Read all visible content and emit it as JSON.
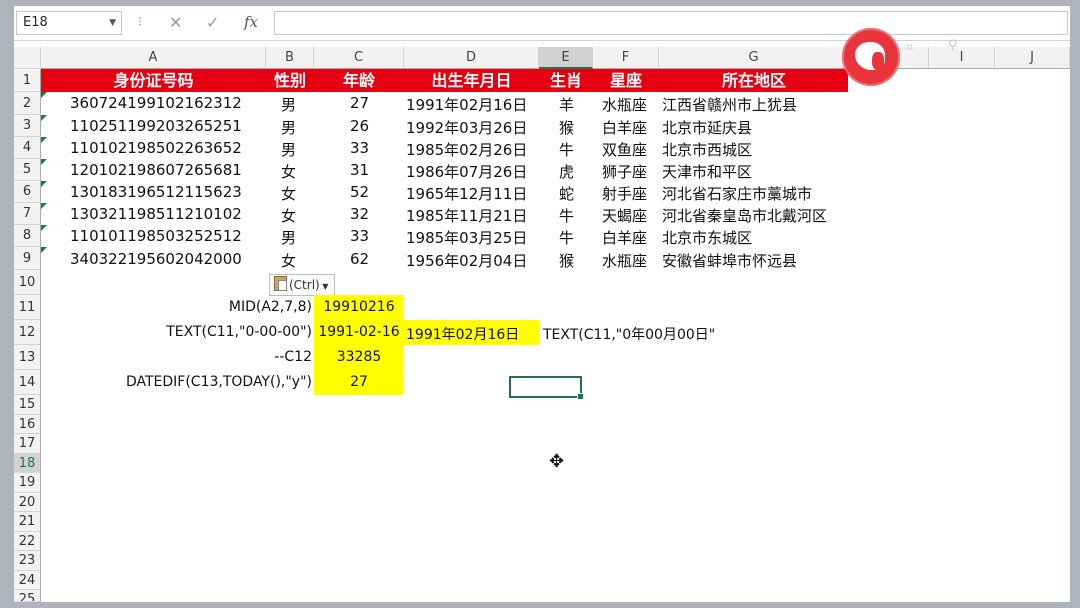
{
  "formula_bar": {
    "name_box": "E18",
    "fx_label": "fx",
    "cancel_icon": "✕",
    "enter_icon": "✓",
    "separator": "⁝"
  },
  "columns": [
    "A",
    "B",
    "C",
    "D",
    "E",
    "F",
    "G",
    "H",
    "I",
    "J"
  ],
  "rows": [
    "1",
    "2",
    "3",
    "4",
    "5",
    "6",
    "7",
    "8",
    "9",
    "10",
    "11",
    "12",
    "13",
    "14",
    "15",
    "16",
    "17",
    "18",
    "19",
    "20",
    "21",
    "22",
    "23",
    "24",
    "25"
  ],
  "header_row": [
    "身份证号码",
    "性别",
    "年龄",
    "出生年月日",
    "生肖",
    "星座",
    "所在地区"
  ],
  "data_rows": [
    [
      "360724199102162312",
      "男",
      "27",
      "1991年02月16日",
      "羊",
      "水瓶座",
      "江西省赣州市上犹县"
    ],
    [
      "110251199203265251",
      "男",
      "26",
      "1992年03月26日",
      "猴",
      "白羊座",
      "北京市延庆县"
    ],
    [
      "110102198502263652",
      "男",
      "33",
      "1985年02月26日",
      "牛",
      "双鱼座",
      "北京市西城区"
    ],
    [
      "120102198607265681",
      "女",
      "31",
      "1986年07月26日",
      "虎",
      "狮子座",
      "天津市和平区"
    ],
    [
      "130183196512115623",
      "女",
      "52",
      "1965年12月11日",
      "蛇",
      "射手座",
      "河北省石家庄市藁城市"
    ],
    [
      "130321198511210102",
      "女",
      "32",
      "1985年11月21日",
      "牛",
      "天蝎座",
      "河北省秦皇岛市北戴河区"
    ],
    [
      "110101198503252512",
      "男",
      "33",
      "1985年03月25日",
      "牛",
      "白羊座",
      "北京市东城区"
    ],
    [
      "340322195602042000",
      "女",
      "62",
      "1956年02月04日",
      "猴",
      "水瓶座",
      "安徽省蚌埠市怀远县"
    ]
  ],
  "paste_button": "(Ctrl)",
  "formulas": [
    {
      "label": "MID(A2,7,8)",
      "result": "19910216"
    },
    {
      "label": "TEXT(C11,\"0-00-00\")",
      "result": "1991-02-16",
      "extra": "1991年02月16日",
      "note": "TEXT(C11,\"0年00月00日\""
    },
    {
      "label": "--C12",
      "result": "33285"
    },
    {
      "label": "DATEDIF(C13,TODAY(),\"y\")",
      "result": "27"
    }
  ],
  "colors": {
    "header_band": "#e60012",
    "highlight": "#ffff00",
    "selection": "#217346"
  }
}
